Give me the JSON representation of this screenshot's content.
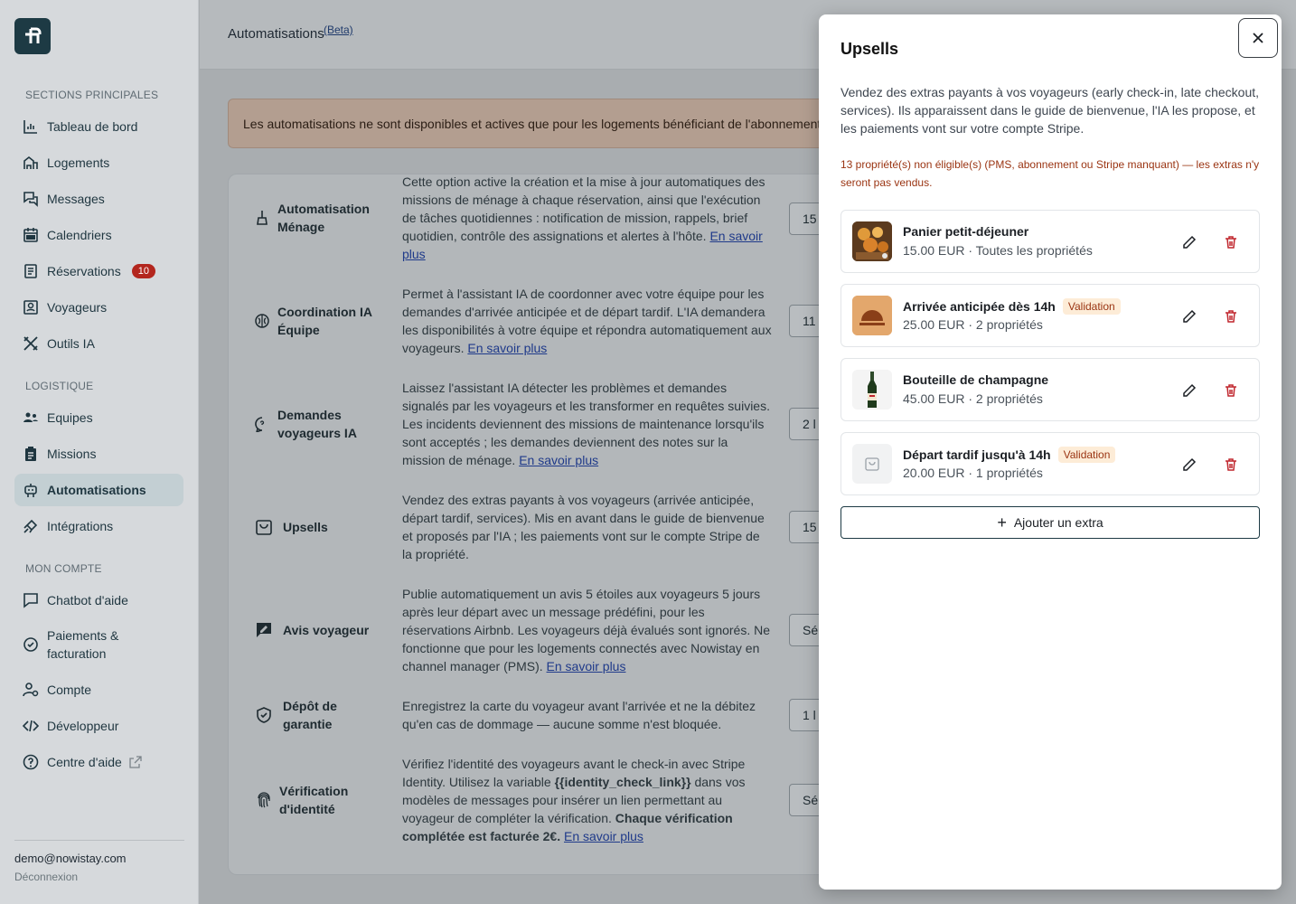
{
  "sidebar": {
    "sections": {
      "main": "SECTIONS PRINCIPALES",
      "logistics": "LOGISTIQUE",
      "account": "MON COMPTE"
    },
    "items": {
      "dashboard": "Tableau de bord",
      "listings": "Logements",
      "messages": "Messages",
      "calendars": "Calendriers",
      "bookings": "Réservations",
      "bookings_badge": "10",
      "guests": "Voyageurs",
      "ai_tools": "Outils IA",
      "teams": "Equipes",
      "missions": "Missions",
      "automations": "Automatisations",
      "integrations": "Intégrations",
      "chatbot": "Chatbot d'aide",
      "payments_1": "Paiements &",
      "payments_2": "facturation",
      "account": "Compte",
      "developer": "Développeur",
      "help": "Centre d'aide"
    },
    "user_email": "demo@nowistay.com",
    "logout": "Déconnexion"
  },
  "header": {
    "title": "Automatisations",
    "beta": "(Beta)"
  },
  "banner": "Les automatisations ne sont disponibles et actives que pour les logements bénéficiant de l'abonnement",
  "rows": [
    {
      "name": "Automatisation Ménage",
      "desc": "Cette option active la création et la mise à jour automatiques des missions de ménage à chaque réservation, ainsi que l'exécution de tâches quotidiennes : notification de mission, rappels, brief quotidien, contrôle des assignations et alertes à l'hôte.",
      "link": "En savoir plus",
      "select": "15"
    },
    {
      "name": "Coordination IA Équipe",
      "desc": "Permet à l'assistant IA de coordonner avec votre équipe pour les demandes d'arrivée anticipée et de départ tardif. L'IA demandera les disponibilités à votre équipe et répondra automatiquement aux voyageurs.",
      "link": "En savoir plus",
      "select": "11"
    },
    {
      "name": "Demandes voyageurs IA",
      "desc": "Laissez l'assistant IA détecter les problèmes et demandes signalés par les voyageurs et les transformer en requêtes suivies. Les incidents deviennent des missions de maintenance lorsqu'ils sont acceptés ; les demandes deviennent des notes sur la mission de ménage.",
      "link": "En savoir plus",
      "select": "2 l"
    },
    {
      "name": "Upsells",
      "desc": "Vendez des extras payants à vos voyageurs (arrivée anticipée, départ tardif, services). Mis en avant dans le guide de bienvenue et proposés par l'IA ; les paiements vont sur le compte Stripe de la propriété.",
      "link": "",
      "select": "15"
    },
    {
      "name": "Avis voyageur",
      "desc": "Publie automatiquement un avis 5 étoiles aux voyageurs 5 jours après leur départ avec un message prédéfini, pour les réservations Airbnb. Les voyageurs déjà évalués sont ignorés. Ne fonctionne que pour les logements connectés avec Nowistay en channel manager (PMS).",
      "link": "En savoir plus",
      "select": "Sél"
    },
    {
      "name": "Dépôt de garantie",
      "desc": "Enregistrez la carte du voyageur avant l'arrivée et ne la débitez qu'en cas de dommage — aucune somme n'est bloquée.",
      "link": "",
      "select": "1 l"
    },
    {
      "name": "Vérification d'identité",
      "desc_1": "Vérifiez l'identité des voyageurs avant le check-in avec Stripe Identity. Utilisez la variable ",
      "desc_var": "{{identity_check_link}}",
      "desc_2": " dans vos modèles de messages pour insérer un lien permettant au voyageur de compléter la vérification. ",
      "desc_bold": "Chaque vérification complétée est facturée 2€.",
      "link": "En savoir plus",
      "select": "Sél"
    }
  ],
  "modal": {
    "title": "Upsells",
    "description": "Vendez des extras payants à vos voyageurs (early check-in, late checkout, services). Ils apparaissent dans le guide de bienvenue, l'IA les propose, et les paiements vont sur votre compte Stripe.",
    "warning": "13 propriété(s) non éligible(s) (PMS, abonnement ou Stripe manquant) — les extras n'y seront pas vendus.",
    "extras": [
      {
        "name": "Panier petit-déjeuner",
        "details": "15.00 EUR · Toutes les propriétés",
        "badge": "",
        "thumb": "breakfast-basket"
      },
      {
        "name": "Arrivée anticipée dès 14h",
        "details": "25.00 EUR · 2 propriétés",
        "badge": "Validation",
        "thumb": "early-arrival"
      },
      {
        "name": "Bouteille de champagne",
        "details": "45.00 EUR · 2 propriétés",
        "badge": "",
        "thumb": "champagne-bottle"
      },
      {
        "name": "Départ tardif jusqu'à 14h",
        "details": "20.00 EUR · 1 propriétés",
        "badge": "Validation",
        "thumb": "bag-placeholder"
      }
    ],
    "add_button": "Ajouter un extra"
  },
  "colors": {
    "brand": "#1d3a44",
    "badge_red": "#b3261e",
    "warning_text": "#9a3412",
    "validation_bg": "#fdecd7"
  }
}
